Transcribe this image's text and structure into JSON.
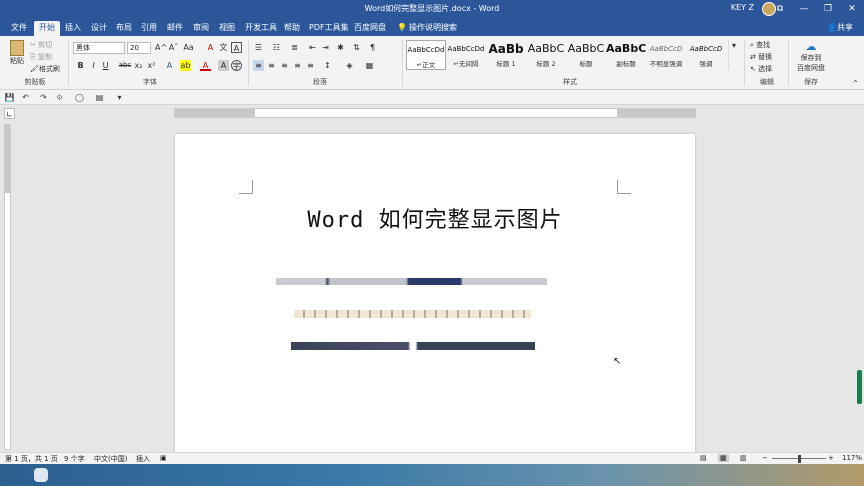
{
  "titlebar": {
    "title": "Word如何完整显示图片.docx - Word",
    "user": "KEY Z",
    "min": "—",
    "restore": "❐",
    "close": "✕",
    "opt": "⧉"
  },
  "tabs": [
    "文件",
    "开始",
    "插入",
    "设计",
    "布局",
    "引用",
    "邮件",
    "审阅",
    "视图",
    "开发工具",
    "帮助",
    "PDF工具集",
    "百度网盘"
  ],
  "active_tab": "开始",
  "tellme": "操作说明搜索",
  "share": "共享",
  "clipboard": {
    "paste": "粘贴",
    "cut": "剪切",
    "copy": "复制",
    "painter": "格式刷",
    "label": "剪贴板"
  },
  "font": {
    "name": "黑体",
    "size": "20",
    "label": "字体",
    "bold": "B",
    "italic": "I",
    "underline": "U",
    "strike": "abc",
    "sub": "x₂",
    "sup": "x²",
    "grow": "A^",
    "shrink": "Aˇ",
    "case": "Aa",
    "clear": "A",
    "color": "A",
    "highlight": "ab",
    "shade": "A",
    "border": "A"
  },
  "paragraph": {
    "label": "段落"
  },
  "styles": {
    "label": "样式",
    "items": [
      {
        "sample": "AaBbCcDd",
        "name": "↵正文"
      },
      {
        "sample": "AaBbCcDd",
        "name": "↵无间隔"
      },
      {
        "sample": "AaBb",
        "name": "标题 1"
      },
      {
        "sample": "AaBbC",
        "name": "标题 2"
      },
      {
        "sample": "AaBbC",
        "name": "标题"
      },
      {
        "sample": "AaBbC",
        "name": "副标题"
      },
      {
        "sample": "AaBbCcD",
        "name": "不明显强调"
      },
      {
        "sample": "AaBbCcD",
        "name": "强调"
      }
    ]
  },
  "editing": {
    "find": "查找",
    "replace": "替换",
    "select": "选择",
    "label": "编辑"
  },
  "save": {
    "line1": "保存到",
    "line2": "百度网盘",
    "label": "保存"
  },
  "document": {
    "title": "Word 如何完整显示图片"
  },
  "status": {
    "page": "第 1 页，共 1 页",
    "words": "9 个字",
    "lang": "中文(中国)",
    "mode": "插入",
    "zoom": "117%"
  },
  "colors": {
    "accent": "#2b579a",
    "scroll": "#1a7b4c"
  }
}
